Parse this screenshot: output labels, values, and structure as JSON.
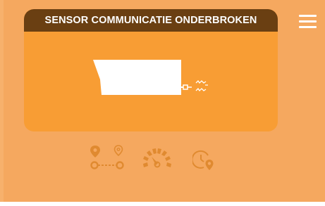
{
  "card": {
    "title": "SENSOR COMMUNICATIE ONDERBROKEN"
  },
  "icons": {
    "menu": "hamburger-menu-icon",
    "sensor": "disconnected-sensor-icon",
    "route": "route-icon",
    "gauge": "speedometer-icon",
    "history": "clock-location-icon"
  },
  "colors": {
    "background": "#f5a85f",
    "card": "#f89d34",
    "header": "#6a3f12",
    "icon": "#e08a30"
  }
}
